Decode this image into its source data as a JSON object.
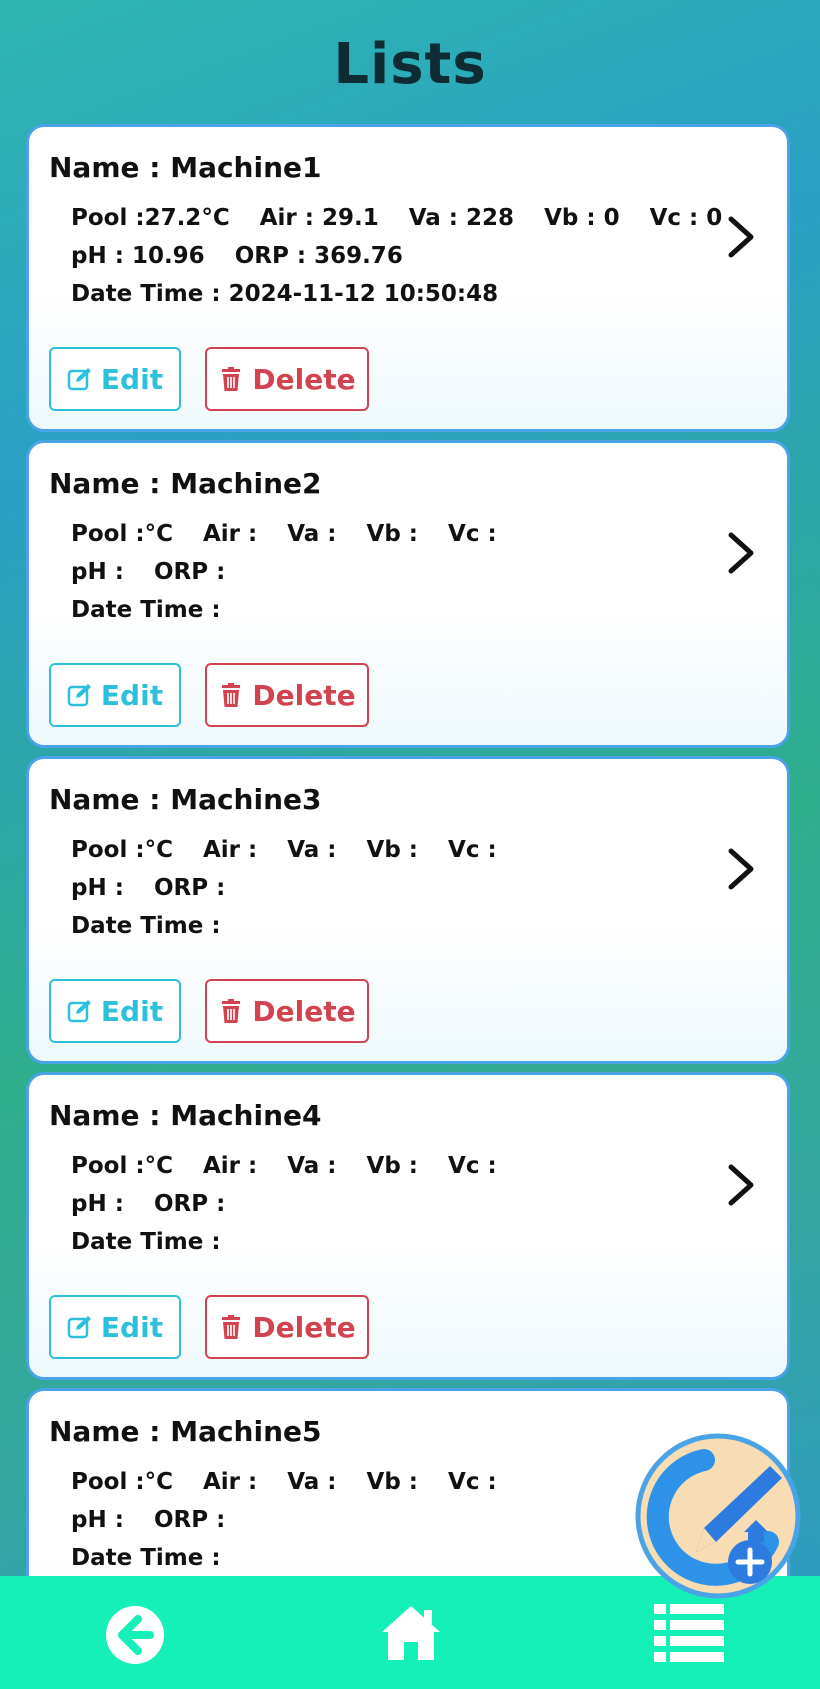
{
  "page": {
    "title": "Lists"
  },
  "labels": {
    "name": "Name :",
    "pool": "Pool :",
    "pool_unit": "°C",
    "air": "Air :",
    "va": "Va :",
    "vb": "Vb :",
    "vc": "Vc :",
    "ph": "pH :",
    "orp": "ORP :",
    "datetime": "Date Time :",
    "edit": "Edit",
    "delete": "Delete"
  },
  "machines": [
    {
      "name": "Machine1",
      "pool": "27.2",
      "air": "29.1",
      "va": "228",
      "vb": "0",
      "vc": "0",
      "ph": "10.96",
      "orp": "369.76",
      "datetime": "2024-11-12 10:50:48"
    },
    {
      "name": "Machine2",
      "pool": "",
      "air": "",
      "va": "",
      "vb": "",
      "vc": "",
      "ph": "",
      "orp": "",
      "datetime": ""
    },
    {
      "name": "Machine3",
      "pool": "",
      "air": "",
      "va": "",
      "vb": "",
      "vc": "",
      "ph": "",
      "orp": "",
      "datetime": ""
    },
    {
      "name": "Machine4",
      "pool": "",
      "air": "",
      "va": "",
      "vb": "",
      "vc": "",
      "ph": "",
      "orp": "",
      "datetime": ""
    },
    {
      "name": "Machine5",
      "pool": "",
      "air": "",
      "va": "",
      "vb": "",
      "vc": "",
      "ph": "",
      "orp": "",
      "datetime": ""
    }
  ],
  "icons": {
    "chevron": "chevron-right-icon",
    "edit": "edit-icon",
    "delete": "trash-icon",
    "back": "back-arrow-icon",
    "home": "home-icon",
    "list": "list-icon",
    "fab": "add-edit-icon"
  },
  "colors": {
    "edit": "#2cc0da",
    "delete": "#d2434f",
    "navbar": "#15f0b9",
    "card_border": "#4aa3e6"
  }
}
